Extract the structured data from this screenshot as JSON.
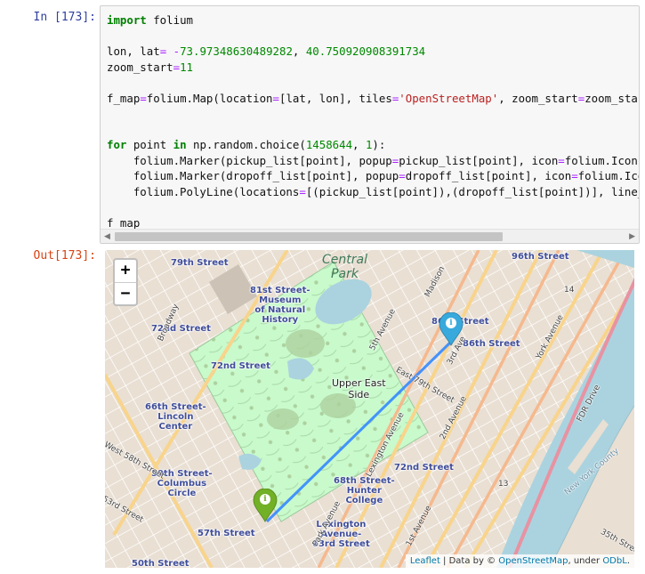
{
  "cell": {
    "in_prompt": "In [173]:",
    "out_prompt": "Out[173]:"
  },
  "code_lines": [
    "import folium",
    "",
    "lon, lat= -73.97348630489282, 40.750920908391734",
    "zoom_start=11",
    "",
    "f_map=folium.Map(location=[lat, lon], tiles='OpenStreetMap', zoom_start=zoom_start)",
    "",
    "",
    "for point in np.random.choice(1458644, 1):",
    "    folium.Marker(pickup_list[point], popup=pickup_list[point], icon=folium.Icon(color",
    "    folium.Marker(dropoff_list[point], popup=dropoff_list[point], icon=folium.Icon(co",
    "    folium.PolyLine(locations=[(pickup_list[point]),(dropoff_list[point])], line_opaci",
    "",
    "f_map"
  ],
  "map": {
    "zoom_in": "+",
    "zoom_out": "−",
    "labels": {
      "central_park": "Central\nPark",
      "79th_street": "79th Street",
      "96th_street": "96th Street",
      "museum": "81st Street-\nMuseum\nof Natural\nHistory",
      "72nd_street_w1": "72nd Street",
      "72nd_street_w2": "72nd Street",
      "broadway": "Broadway",
      "66th_lincoln": "66th Street-\nLincoln\nCenter",
      "upper_east_side": "Upper East\nSide",
      "86th_street_a": "86th Street",
      "86th_street_b": "86th Street",
      "72nd_street_e": "72nd Street",
      "59th_columbus": "59th Street-\nColumbus\nCircle",
      "68th_hunter": "68th Street-\nHunter\nCollege",
      "lexington_63": "Lexington\nAvenue-\n63rd Street",
      "57th_street": "57th Street",
      "50th_street": "50th Street",
      "west_58th": "West 58th Street",
      "53rd_street": "53rd Street",
      "5th_avenue": "5th Avenue",
      "park_avenue": "Park Avenue",
      "lexington_ave": "Lexington Avenue",
      "2nd_avenue": "2nd Avenue",
      "york_avenue": "York Avenue",
      "fdr_drive": "FDR Drive",
      "madison": "Madison",
      "east_79th": "East 79th Street",
      "1st_avenue": "1st Avenue",
      "3rd_ave": "3rd Ave",
      "num_14": "14",
      "num_13": "13",
      "35th_street": "35th Street",
      "new_york_county": "New York County"
    },
    "markers": {
      "dropoff_icon": "i",
      "pickup_icon": "i"
    },
    "attribution": {
      "leaflet": "Leaflet",
      "sep": " | Data by © ",
      "osm": "OpenStreetMap",
      "under": ", under ",
      "odbl": "ODbL",
      "end": "."
    }
  },
  "colors": {
    "prompt_in": "#303f9f",
    "prompt_out": "#d84315",
    "marker_blue": "#38a9dc",
    "marker_green": "#72b026",
    "route_line": "#3388ff",
    "water": "#aad3df",
    "park": "#c8facc"
  }
}
